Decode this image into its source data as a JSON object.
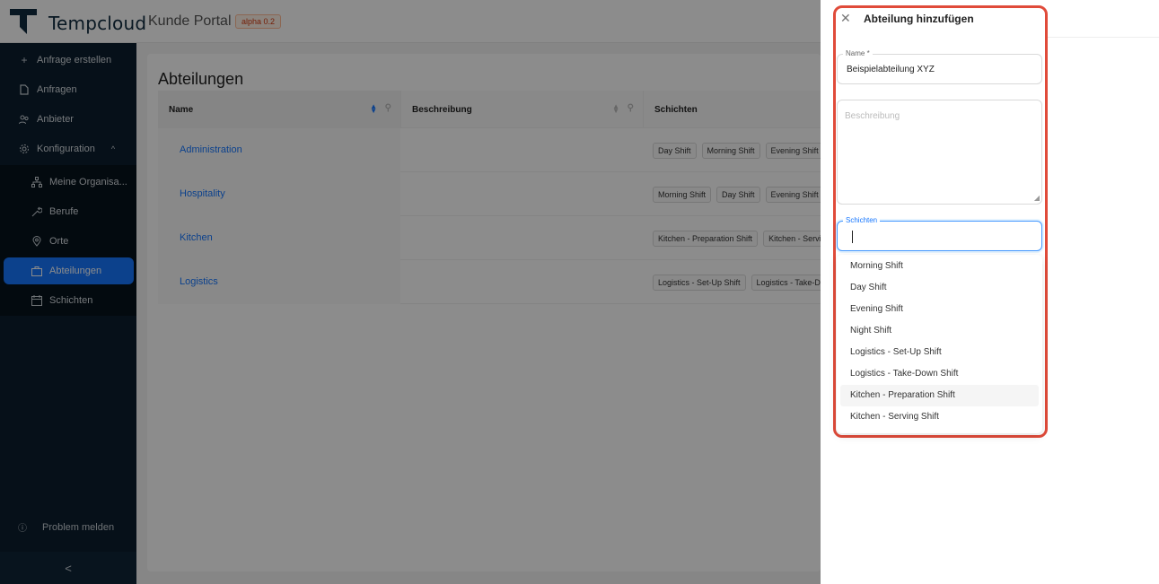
{
  "header": {
    "brand": "Tempcloud",
    "portal": "Kunde Portal",
    "badge": "alpha 0.2"
  },
  "sidebar": {
    "items": [
      {
        "label": "Anfrage erstellen",
        "icon": "plus-icon"
      },
      {
        "label": "Anfragen",
        "icon": "file-icon"
      },
      {
        "label": "Anbieter",
        "icon": "team-icon"
      },
      {
        "label": "Konfiguration",
        "icon": "gear-icon"
      },
      {
        "label": "Meine Organisa...",
        "icon": "org-icon"
      },
      {
        "label": "Berufe",
        "icon": "tool-icon"
      },
      {
        "label": "Orte",
        "icon": "location-icon"
      },
      {
        "label": "Abteilungen",
        "icon": "briefcase-icon"
      },
      {
        "label": "Schichten",
        "icon": "calendar-icon"
      }
    ],
    "problem": "Problem melden",
    "collapse": "<"
  },
  "main": {
    "title": "Abteilungen",
    "columns": [
      "Name",
      "Beschreibung",
      "Schichten"
    ],
    "rows": [
      {
        "name": "Administration",
        "description": "",
        "shifts": [
          "Day Shift",
          "Morning Shift",
          "Evening Shift"
        ]
      },
      {
        "name": "Hospitality",
        "description": "",
        "shifts": [
          "Morning Shift",
          "Day Shift",
          "Evening Shift"
        ]
      },
      {
        "name": "Kitchen",
        "description": "",
        "shifts": [
          "Kitchen - Preparation Shift",
          "Kitchen - Serving Shift"
        ]
      },
      {
        "name": "Logistics",
        "description": "",
        "shifts": [
          "Logistics - Set-Up Shift",
          "Logistics - Take-Down Shift"
        ]
      }
    ]
  },
  "drawer": {
    "title": "Abteilung hinzufügen",
    "name_label": "Name *",
    "name_value": "Beispielabteilung XYZ",
    "desc_placeholder": "Beschreibung",
    "shifts_label": "Schichten",
    "options": [
      "Morning Shift",
      "Day Shift",
      "Evening Shift",
      "Night Shift",
      "Logistics - Set-Up Shift",
      "Logistics - Take-Down Shift",
      "Kitchen - Preparation Shift",
      "Kitchen - Serving Shift"
    ]
  },
  "colors": {
    "primary": "#1677ff",
    "sidebar": "#0b1e2e",
    "highlight": "#e04b3a"
  }
}
